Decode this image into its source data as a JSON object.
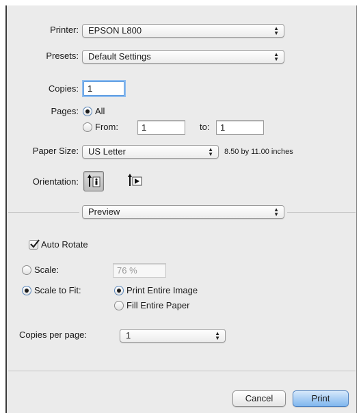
{
  "printer": {
    "label": "Printer:",
    "value": "EPSON L800"
  },
  "presets": {
    "label": "Presets:",
    "value": "Default Settings"
  },
  "copies": {
    "label": "Copies:",
    "value": "1"
  },
  "pages": {
    "label": "Pages:",
    "all_label": "All",
    "from_label": "From:",
    "from_value": "1",
    "to_label": "to:",
    "to_value": "1",
    "selected": "All"
  },
  "paper_size": {
    "label": "Paper Size:",
    "value": "US Letter",
    "dimensions": "8.50 by 11.00 inches"
  },
  "orientation": {
    "label": "Orientation:",
    "selected": "portrait",
    "portrait_icon": "portrait-orientation-icon",
    "landscape_icon": "landscape-orientation-icon"
  },
  "section": {
    "value": "Preview"
  },
  "auto_rotate": {
    "label": "Auto Rotate",
    "checked": true
  },
  "scale": {
    "label": "Scale:",
    "value": "76 %"
  },
  "scale_to_fit": {
    "label": "Scale to Fit:",
    "print_entire_image": "Print Entire Image",
    "fill_entire_paper": "Fill Entire Paper",
    "selected": "Print Entire Image"
  },
  "copies_per_page": {
    "label": "Copies per page:",
    "value": "1"
  },
  "buttons": {
    "cancel": "Cancel",
    "print": "Print"
  },
  "colors": {
    "dialog_bg": "#ebebeb",
    "focus_ring": "#8fbdf0",
    "default_button": "#7fb6ee"
  }
}
